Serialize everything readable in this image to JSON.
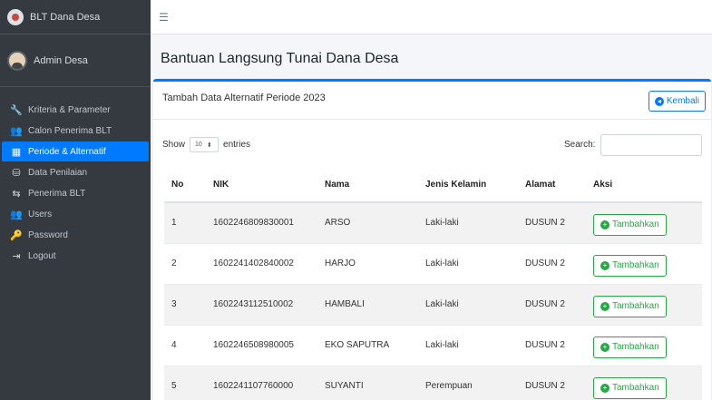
{
  "brand": {
    "title": "BLT Dana Desa"
  },
  "user": {
    "name": "Admin Desa"
  },
  "sidebar": {
    "items": [
      {
        "label": "Kriteria & Parameter",
        "icon": "wrench-icon",
        "glyph": "🔧",
        "active": false
      },
      {
        "label": "Calon Penerima BLT",
        "icon": "users-icon",
        "glyph": "👥",
        "active": false
      },
      {
        "label": "Periode & Alternatif",
        "icon": "calendar-icon",
        "glyph": "▦",
        "active": true
      },
      {
        "label": "Data Penilaian",
        "icon": "database-icon",
        "glyph": "⛁",
        "active": false
      },
      {
        "label": "Penerima BLT",
        "icon": "people-arrows-icon",
        "glyph": "⇆",
        "active": false
      },
      {
        "label": "Users",
        "icon": "user-group-icon",
        "glyph": "👥",
        "active": false
      },
      {
        "label": "Password",
        "icon": "key-icon",
        "glyph": "🔑",
        "active": false
      },
      {
        "label": "Logout",
        "icon": "sign-out-icon",
        "glyph": "⇥",
        "active": false
      }
    ]
  },
  "page": {
    "title": "Bantuan Langsung Tunai Dana Desa"
  },
  "card": {
    "title": "Tambah Data Alternatif Periode 2023",
    "back_label": "Kembali"
  },
  "controls": {
    "show_label": "Show",
    "length_value": "10",
    "entries_label": "entries",
    "search_label": "Search:"
  },
  "table": {
    "headers": [
      "No",
      "NIK",
      "Nama",
      "Jenis Kelamin",
      "Alamat",
      "Aksi"
    ],
    "action_label": "Tambahkan",
    "rows": [
      {
        "no": "1",
        "nik": "1602246809830001",
        "nama": "ARSO",
        "jk": "Laki-laki",
        "alamat": "DUSUN 2"
      },
      {
        "no": "2",
        "nik": "1602241402840002",
        "nama": "HARJO",
        "jk": "Laki-laki",
        "alamat": "DUSUN 2"
      },
      {
        "no": "3",
        "nik": "1602243112510002",
        "nama": "HAMBALI",
        "jk": "Laki-laki",
        "alamat": "DUSUN 2"
      },
      {
        "no": "4",
        "nik": "1602246508980005",
        "nama": "EKO SAPUTRA",
        "jk": "Laki-laki",
        "alamat": "DUSUN 2"
      },
      {
        "no": "5",
        "nik": "1602241107760000",
        "nama": "SUYANTI",
        "jk": "Perempuan",
        "alamat": "DUSUN 2"
      }
    ]
  },
  "colors": {
    "primary": "#007bff",
    "success": "#28a745",
    "sidebar": "#343a40"
  }
}
